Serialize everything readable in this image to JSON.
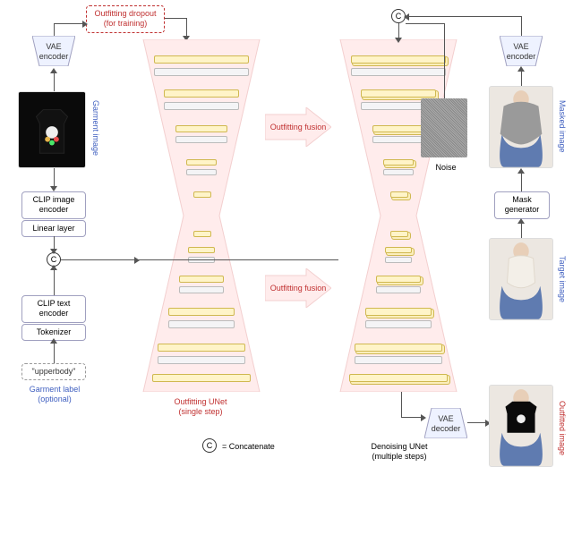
{
  "labels": {
    "outfitting_dropout": "Outfitting dropout\n(for training)",
    "vae_encoder": "VAE\nencoder",
    "vae_decoder": "VAE\ndecoder",
    "clip_image_encoder": "CLIP image\nencoder",
    "linear_layer": "Linear layer",
    "clip_text_encoder": "CLIP text\nencoder",
    "tokenizer": "Tokenizer",
    "mask_generator": "Mask\ngenerator",
    "upperbody": "\"upperbody\"",
    "garment_label_optional": "Garment label\n(optional)",
    "garment_image": "Garment image",
    "masked_image": "Masked image",
    "target_image": "Target image",
    "outfitted_image": "Outfitted image",
    "noise": "Noise",
    "concat_symbol": "C",
    "concat_legend": "= Concatenate",
    "outfitting_unet": "Outfitting UNet",
    "outfitting_unet_sub": "(single step)",
    "denoising_unet": "Denoising UNet",
    "denoising_unet_sub": "(multiple steps)",
    "outfitting_fusion": "Outfitting fusion"
  }
}
